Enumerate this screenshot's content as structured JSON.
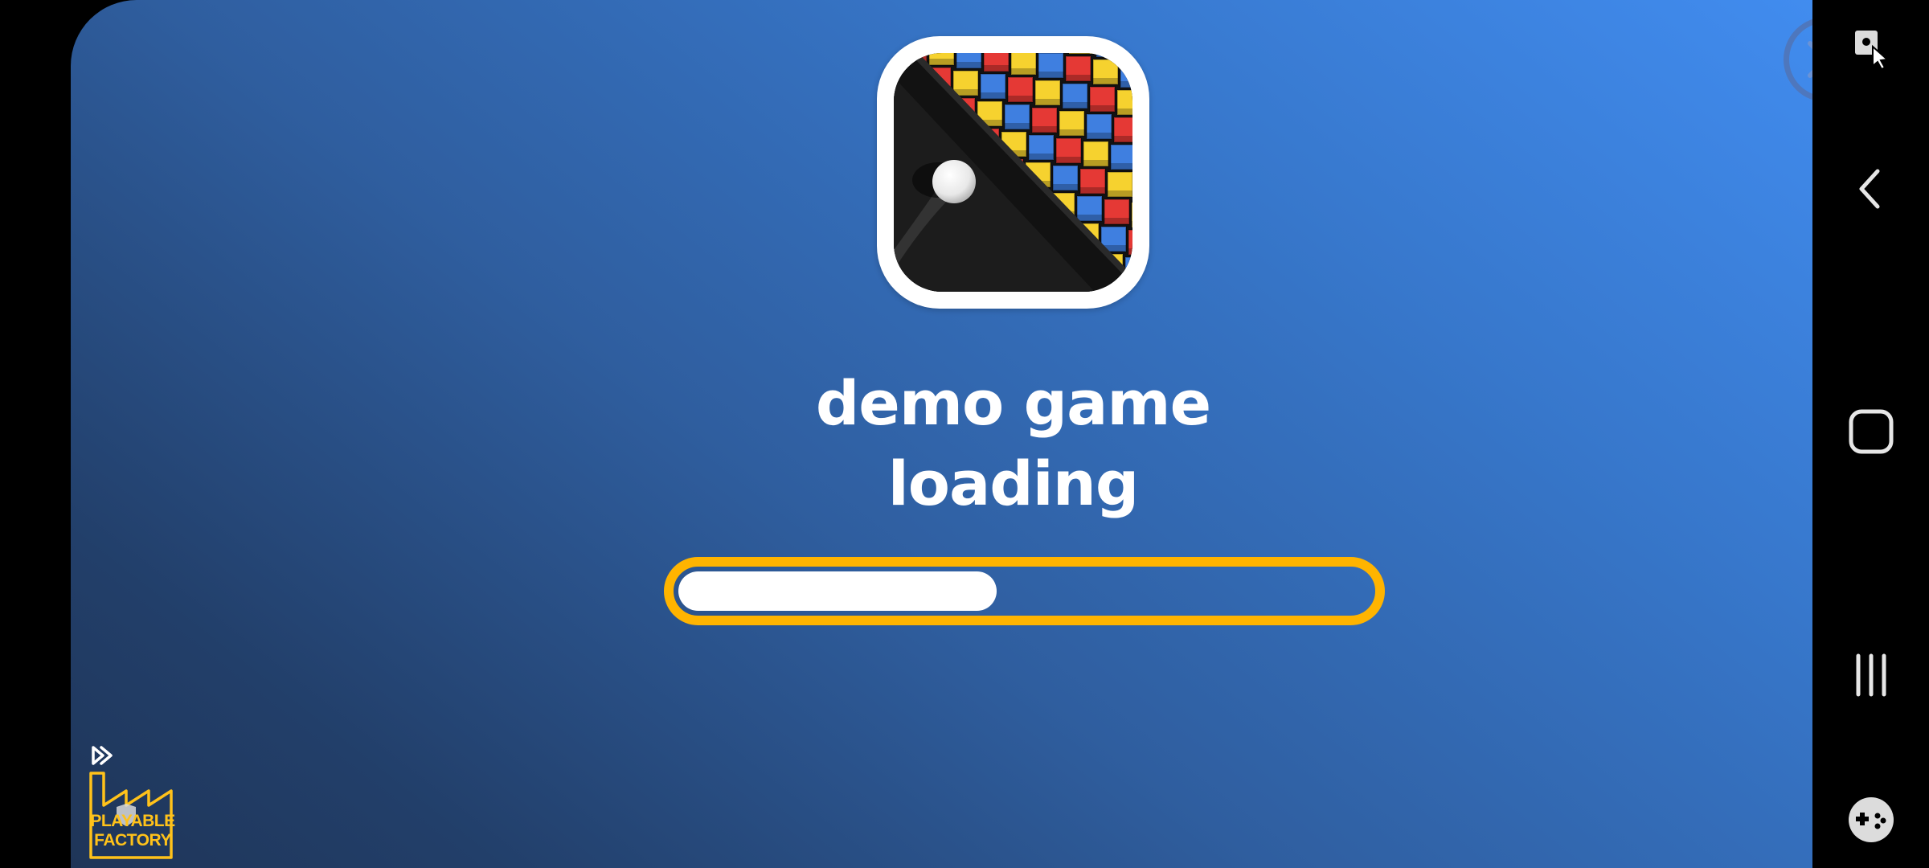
{
  "game": {
    "title_line1": "demo game",
    "title_line2": "loading",
    "progress_percent": 46,
    "colors": {
      "background_top_right": "#418cef",
      "background_bottom_left": "#1f3558",
      "progress_border": "#ffb400",
      "progress_fill": "#ffffff",
      "close_button": "#4e77bd"
    }
  },
  "app_icon": {
    "icon": "block-breaker-game-icon",
    "tile_colors": [
      "#e53935",
      "#f6d22f",
      "#3f7fe0"
    ]
  },
  "close_button": {
    "icon": "close-icon"
  },
  "branding": {
    "logo_line1": "PLAYABLE",
    "logo_line2": "FACTORY",
    "logo_color": "#ffc21a",
    "skip_icon": "fast-forward-icon"
  },
  "nav_bar": {
    "items": [
      {
        "name": "screen-capture",
        "icon": "screen-capture-icon"
      },
      {
        "name": "back",
        "icon": "chevron-left-icon"
      },
      {
        "name": "home",
        "icon": "home-square-icon"
      },
      {
        "name": "recents",
        "icon": "recents-icon"
      },
      {
        "name": "game-tools",
        "icon": "gamepad-icon"
      }
    ]
  }
}
